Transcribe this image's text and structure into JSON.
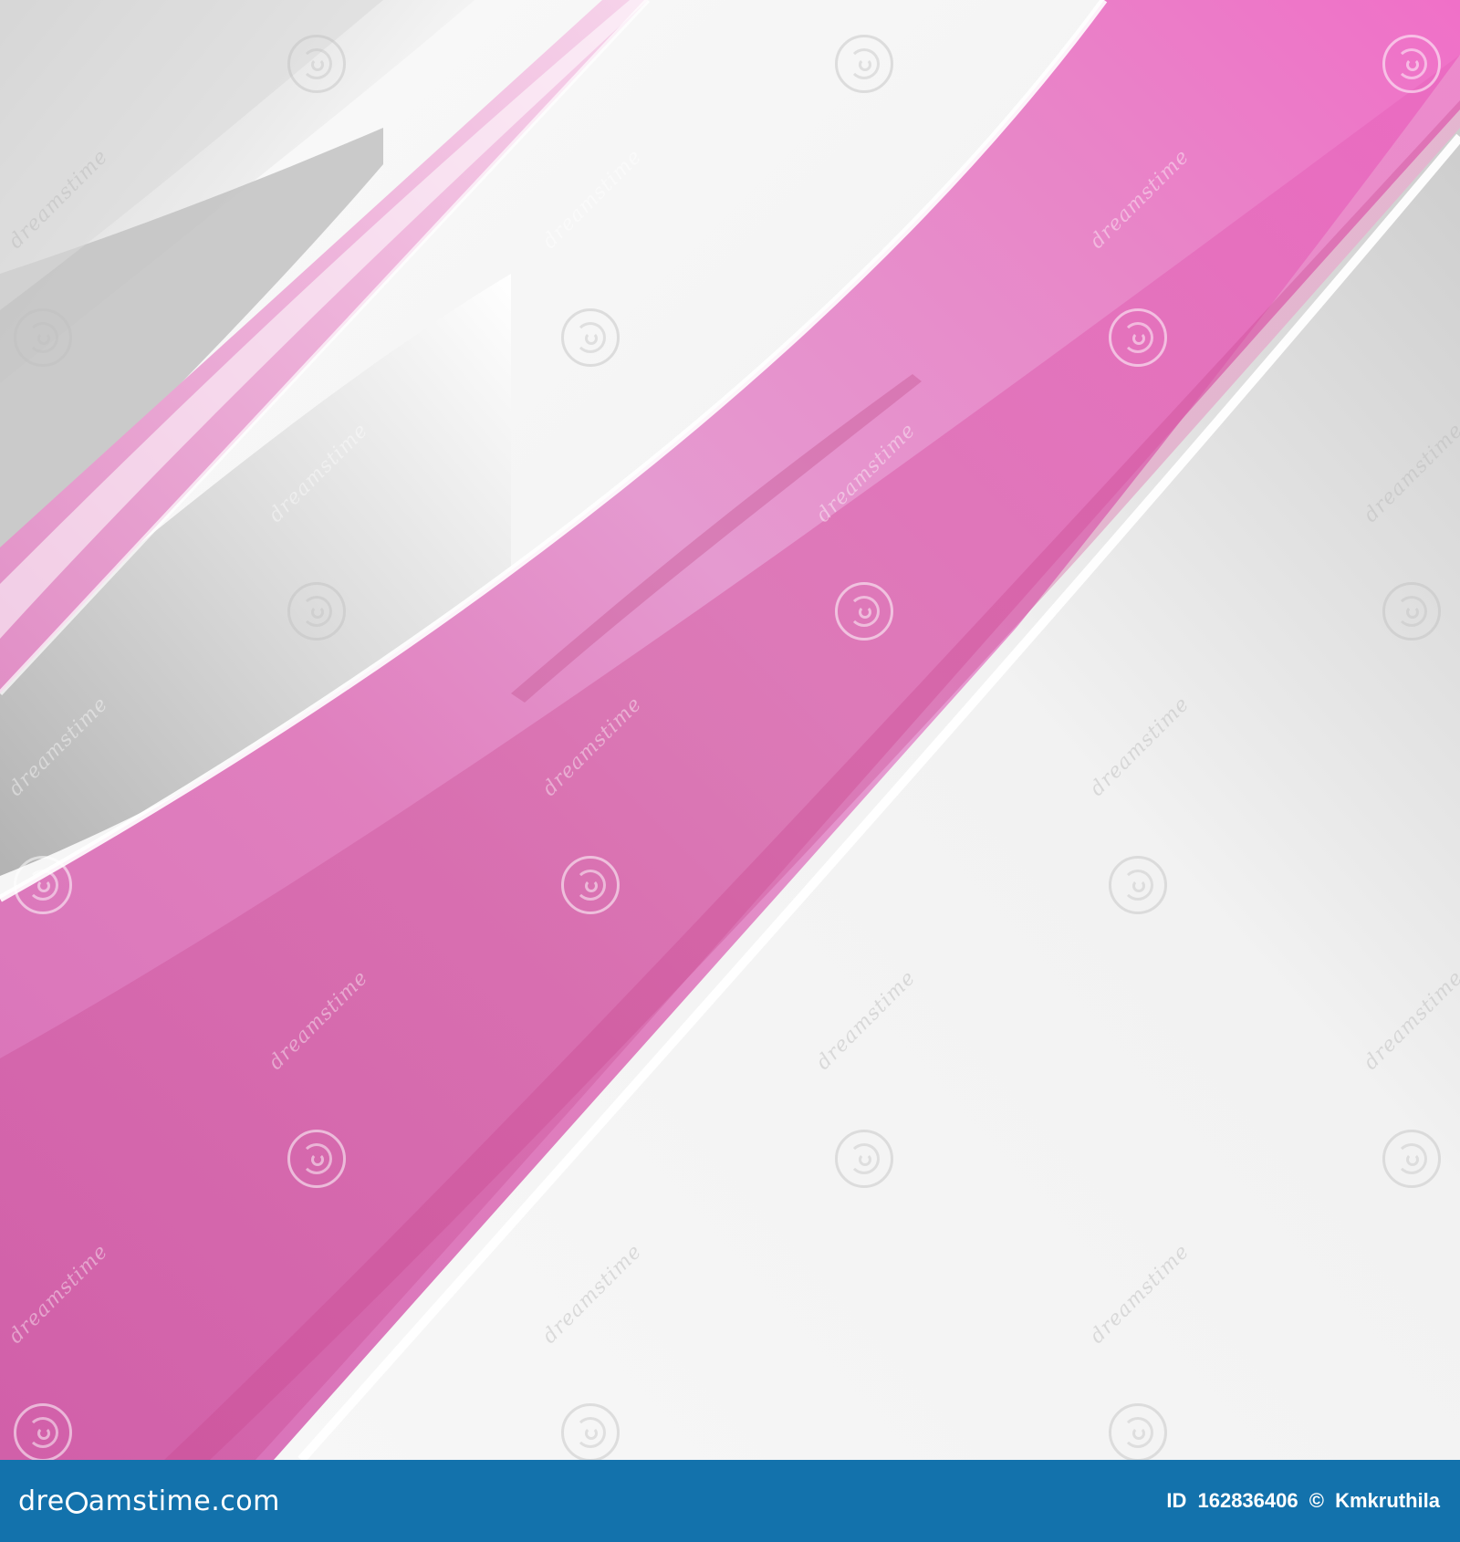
{
  "watermark": {
    "text": "dreamstime"
  },
  "footer": {
    "brand_prefix": "dre",
    "brand_suffix": "amstime.com",
    "id_label": "ID",
    "id_value": "162836406",
    "copyright": "©",
    "author": "Kmkruthila"
  },
  "colors": {
    "pink": "#e27bc4",
    "pink_dark": "#cf4f9c",
    "grey": "#c6c6c6",
    "footer_blue": "#1372ac"
  }
}
